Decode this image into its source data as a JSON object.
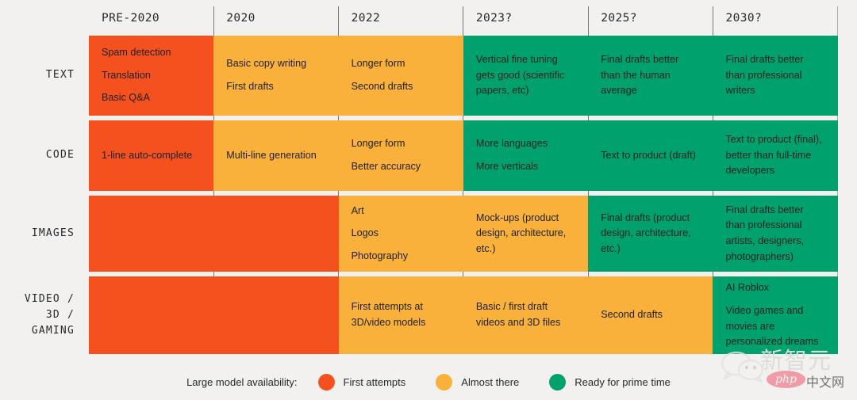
{
  "colors": {
    "background": "#F2F1EF",
    "first_attempts": "#F4511E",
    "almost_there": "#F9B13C",
    "ready_prime_time": "#00A16D",
    "text": "#26292B"
  },
  "columns": [
    {
      "label": "PRE-2020"
    },
    {
      "label": "2020"
    },
    {
      "label": "2022"
    },
    {
      "label": "2023?"
    },
    {
      "label": "2025?"
    },
    {
      "label": "2030?"
    }
  ],
  "rows": [
    {
      "label": "TEXT",
      "cells": [
        {
          "status": "first_attempts",
          "lines": [
            "Spam detection",
            "Translation",
            "Basic Q&A"
          ]
        },
        {
          "status": "almost_there",
          "lines": [
            "Basic copy writing",
            "First drafts"
          ]
        },
        {
          "status": "almost_there",
          "lines": [
            "Longer form",
            "Second drafts"
          ]
        },
        {
          "status": "ready_prime_time",
          "lines": [
            "Vertical fine tuning",
            "gets good (scientific",
            "papers, etc)"
          ],
          "wrapped": true
        },
        {
          "status": "ready_prime_time",
          "lines": [
            "Final drafts better",
            "than the human",
            "average"
          ],
          "wrapped": true
        },
        {
          "status": "ready_prime_time",
          "lines": [
            "Final drafts better",
            "than professional",
            "writers"
          ],
          "wrapped": true
        }
      ]
    },
    {
      "label": "CODE",
      "cells": [
        {
          "status": "first_attempts",
          "lines": [
            "1-line auto-complete"
          ]
        },
        {
          "status": "almost_there",
          "lines": [
            "Multi-line generation"
          ]
        },
        {
          "status": "almost_there",
          "lines": [
            "Longer form",
            "Better accuracy"
          ]
        },
        {
          "status": "ready_prime_time",
          "lines": [
            "More languages",
            "More verticals"
          ]
        },
        {
          "status": "ready_prime_time",
          "lines": [
            "Text to product (draft)"
          ]
        },
        {
          "status": "ready_prime_time",
          "lines": [
            "Text to product (final),",
            "better than full-time",
            "developers"
          ],
          "wrapped": true
        }
      ]
    },
    {
      "label": "IMAGES",
      "cells": [
        {
          "status": "first_attempts",
          "lines": []
        },
        {
          "status": "first_attempts",
          "lines": []
        },
        {
          "status": "almost_there",
          "lines": [
            "Art",
            "Logos",
            "Photography"
          ]
        },
        {
          "status": "almost_there",
          "lines": [
            "Mock-ups (product",
            "design, architecture,",
            "etc.)"
          ],
          "wrapped": true
        },
        {
          "status": "ready_prime_time",
          "lines": [
            "Final drafts (product",
            "design, architecture,",
            "etc.)"
          ],
          "wrapped": true
        },
        {
          "status": "ready_prime_time",
          "lines": [
            "Final drafts better",
            "than professional",
            "artists, designers,",
            "photographers)"
          ],
          "wrapped": true
        }
      ]
    },
    {
      "label": "VIDEO /\n3D /\nGAMING",
      "cells": [
        {
          "status": "first_attempts",
          "lines": []
        },
        {
          "status": "first_attempts",
          "lines": []
        },
        {
          "status": "almost_there",
          "lines": [
            "First attempts at",
            "3D/video models"
          ],
          "wrapped": true
        },
        {
          "status": "almost_there",
          "lines": [
            "Basic / first draft",
            "videos and 3D files"
          ],
          "wrapped": true
        },
        {
          "status": "almost_there",
          "lines": [
            "Second drafts"
          ]
        },
        {
          "status": "ready_prime_time",
          "lines": [
            "AI Roblox",
            "Video games and",
            "movies are",
            "personalized dreams"
          ],
          "wrapped": true,
          "first_line_spaced": true
        }
      ]
    }
  ],
  "legend": {
    "title": "Large model availability:",
    "items": [
      {
        "label": "First attempts",
        "color": "#F4511E",
        "swatch": "circle-swatch-red"
      },
      {
        "label": "Almost there",
        "color": "#F9B13C",
        "swatch": "circle-swatch-amber"
      },
      {
        "label": "Ready for prime time",
        "color": "#00A16D",
        "swatch": "circle-swatch-green"
      }
    ]
  },
  "watermark": {
    "brand_cn": "新智元",
    "badge": "php",
    "suffix": "中文网"
  }
}
